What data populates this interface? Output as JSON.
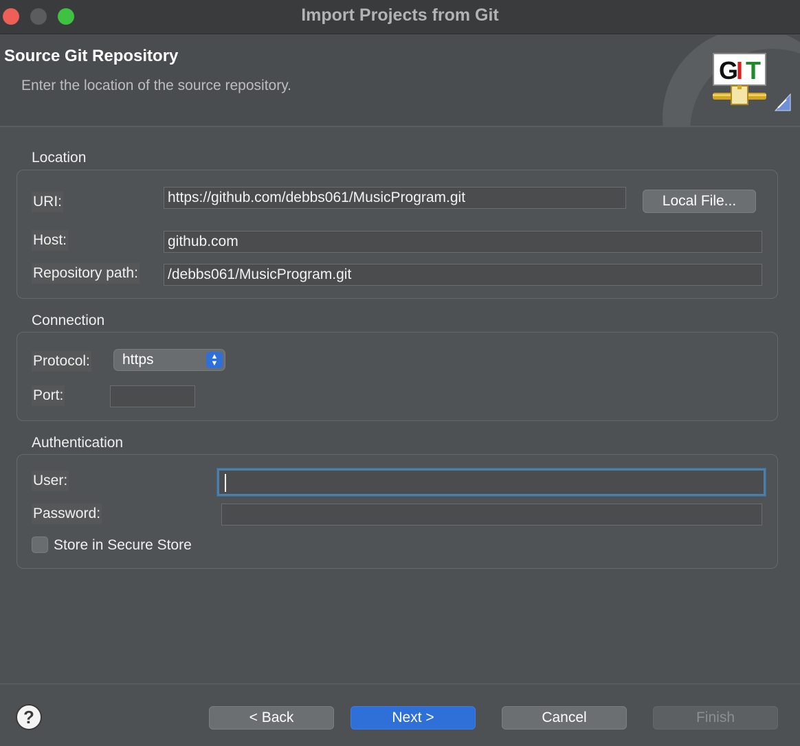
{
  "window": {
    "title": "Import Projects from Git"
  },
  "header": {
    "title": "Source Git Repository",
    "description": "Enter the location of the source repository.",
    "logo_text": [
      "G",
      "I",
      "T"
    ]
  },
  "location": {
    "group_label": "Location",
    "uri_label": "URI:",
    "uri_value": "https://github.com/debbs061/MusicProgram.git",
    "local_file_button": "Local File...",
    "host_label": "Host:",
    "host_value": "github.com",
    "repo_path_label": "Repository path:",
    "repo_path_value": "/debbs061/MusicProgram.git"
  },
  "connection": {
    "group_label": "Connection",
    "protocol_label": "Protocol:",
    "protocol_value": "https",
    "port_label": "Port:",
    "port_value": ""
  },
  "authentication": {
    "group_label": "Authentication",
    "user_label": "User:",
    "user_value": "",
    "password_label": "Password:",
    "password_value": "",
    "store_label": "Store in Secure Store",
    "store_checked": false
  },
  "footer": {
    "help_symbol": "?",
    "back_button": "< Back",
    "next_button": "Next >",
    "cancel_button": "Cancel",
    "finish_button": "Finish"
  },
  "colors": {
    "accent": "#2f6fd8",
    "focus_ring": "#4e7fa8",
    "background": "#4e5153",
    "close": "#ee5f58",
    "maximize": "#3fc242"
  }
}
